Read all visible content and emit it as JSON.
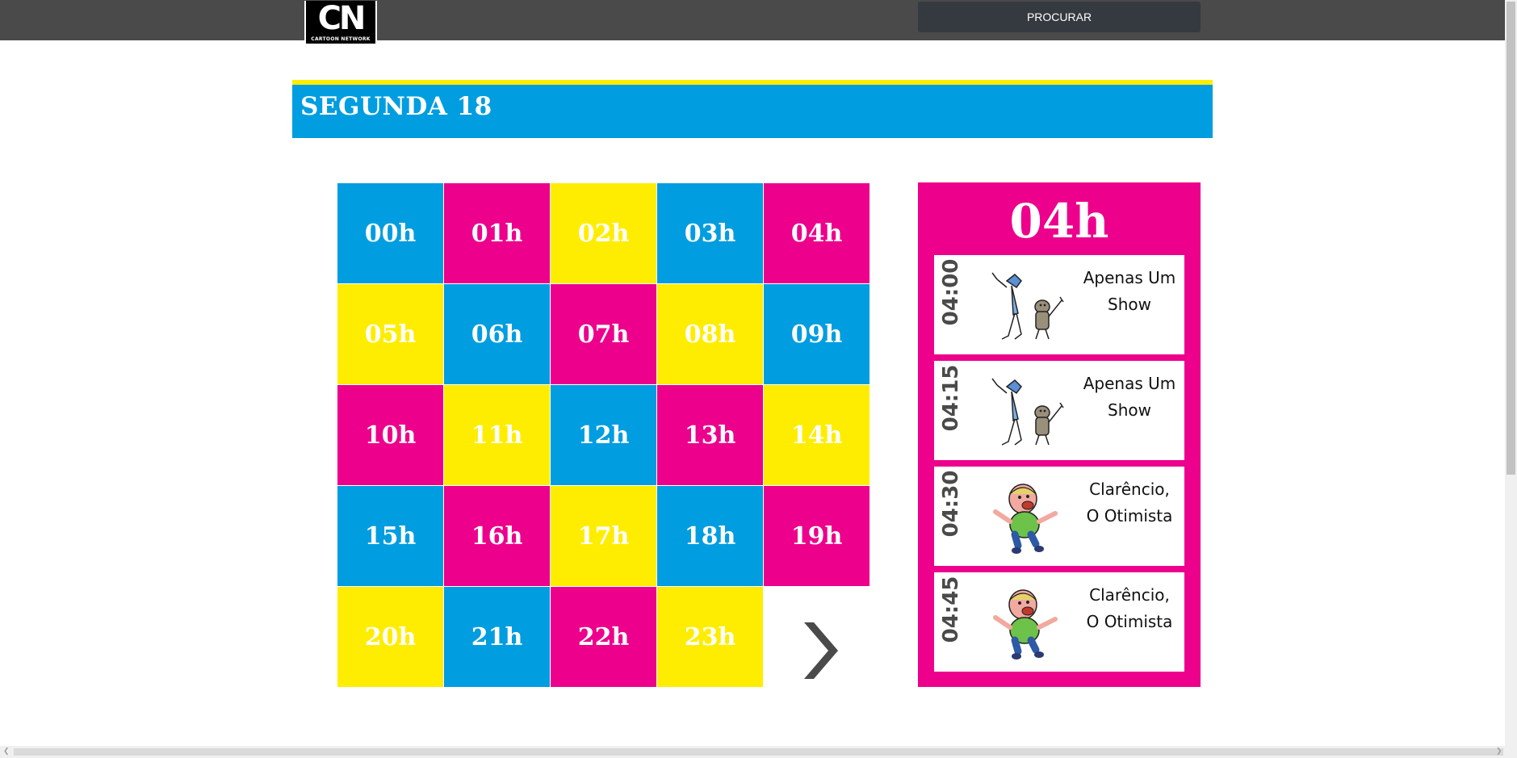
{
  "brand": {
    "logo_letters": "CN",
    "logo_text": "CARTOON NETWORK"
  },
  "header": {
    "search_label": "PROCURAR"
  },
  "day": {
    "title": "SEGUNDA 18"
  },
  "hours": [
    "00h",
    "01h",
    "02h",
    "03h",
    "04h",
    "05h",
    "06h",
    "07h",
    "08h",
    "09h",
    "10h",
    "11h",
    "12h",
    "13h",
    "14h",
    "15h",
    "16h",
    "17h",
    "18h",
    "19h",
    "20h",
    "21h",
    "22h",
    "23h"
  ],
  "colors": {
    "blue": "#009de0",
    "pink": "#ec008c",
    "yellow": "#ffed00",
    "topbar": "#4a4a4a",
    "search_button": "#353a41"
  },
  "panel": {
    "selected_hour": "04h",
    "schedule": [
      {
        "time": "04:00",
        "show": "Apenas Um Show",
        "image": "regular-show-characters"
      },
      {
        "time": "04:15",
        "show": "Apenas Um Show",
        "image": "regular-show-characters"
      },
      {
        "time": "04:30",
        "show": "Clarêncio, O Otimista",
        "image": "clarence-character"
      },
      {
        "time": "04:45",
        "show": "Clarêncio, O Otimista",
        "image": "clarence-character"
      }
    ]
  }
}
